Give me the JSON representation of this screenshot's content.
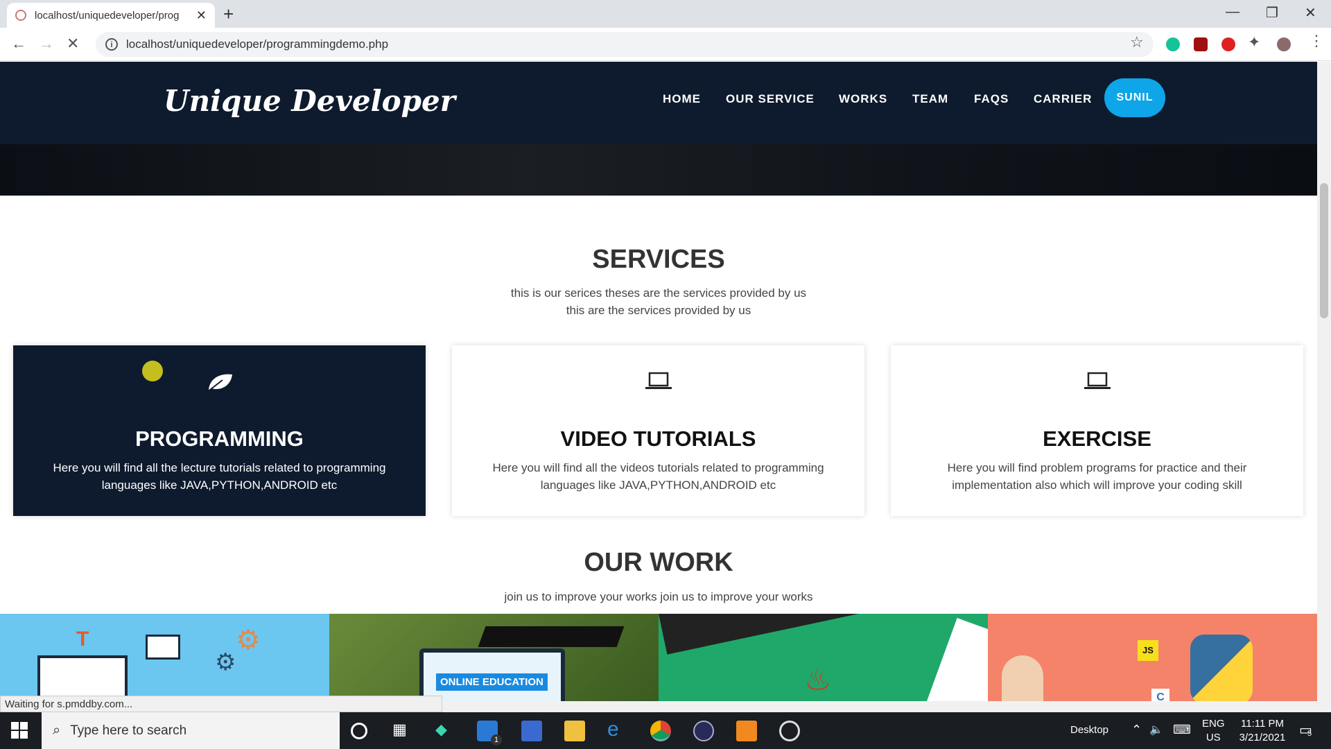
{
  "browser": {
    "tab_title": "localhost/uniquedeveloper/prog",
    "url": "localhost/uniquedeveloper/programmingdemo.php",
    "status_text": "Waiting for s.pmddby.com..."
  },
  "site": {
    "logo": "Unique Developer",
    "nav": [
      "HOME",
      "OUR SERVICE",
      "WORKS",
      "TEAM",
      "FAQS",
      "CARRIER"
    ],
    "user_button": "SUNIL"
  },
  "services": {
    "title": "SERVICES",
    "subtitle_line1": "this is our serices theses are the services provided by us",
    "subtitle_line2": "this are the services provided by us",
    "cards": [
      {
        "title": "PROGRAMMING",
        "desc": "Here you will find all the lecture tutorials related to programming languages like JAVA,PYTHON,ANDROID etc"
      },
      {
        "title": "VIDEO TUTORIALS",
        "desc": "Here you will find all the videos tutorials related to programming languages like JAVA,PYTHON,ANDROID etc"
      },
      {
        "title": "EXERCISE",
        "desc": "Here you will find problem programs for practice and their implementation also which will improve your coding skill"
      }
    ]
  },
  "work": {
    "title": "OUR WORK",
    "subtitle": "join us to improve your works join us to improve your works",
    "online_education_label": "ONLINE EDUCATION",
    "js_label": "JS",
    "c_label": "C"
  },
  "taskbar": {
    "search_placeholder": "Type here to search",
    "desktop_label": "Desktop",
    "lang1": "ENG",
    "lang2": "US",
    "time": "11:11 PM",
    "date": "3/21/2021",
    "mail_badge": "1",
    "notif_count": "5"
  }
}
